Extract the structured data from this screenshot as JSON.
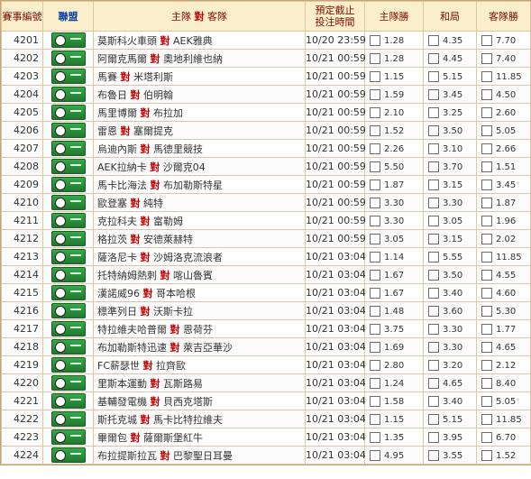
{
  "header": {
    "match_no": "賽事編號",
    "league": "聯盟",
    "home": "主隊",
    "vs": "對",
    "away": "客隊",
    "deadline_line1": "預定截止",
    "deadline_line2": "投注時間",
    "home_win": "主隊勝",
    "draw": "和局",
    "away_win": "客隊勝"
  },
  "vs": "對",
  "rows": [
    {
      "id": "4201",
      "home": "莫斯科火車頭",
      "away": "AEK雅典",
      "time": "10/20 23:59",
      "hw": "1.28",
      "dr": "4.35",
      "aw": "7.70"
    },
    {
      "id": "4202",
      "home": "阿爾克馬爾",
      "away": "奧地利維也納",
      "time": "10/21 00:59",
      "hw": "1.28",
      "dr": "4.45",
      "aw": "7.40"
    },
    {
      "id": "4203",
      "home": "馬賽",
      "away": "米塔利斯",
      "time": "10/21 00:59",
      "hw": "1.15",
      "dr": "5.15",
      "aw": "11.85"
    },
    {
      "id": "4204",
      "home": "布魯日",
      "away": "伯明翰",
      "time": "10/21 00:59",
      "hw": "1.59",
      "dr": "3.45",
      "aw": "4.50"
    },
    {
      "id": "4205",
      "home": "馬里博爾",
      "away": "布拉加",
      "time": "10/21 00:59",
      "hw": "2.10",
      "dr": "3.25",
      "aw": "2.60"
    },
    {
      "id": "4206",
      "home": "雷恩",
      "away": "塞爾提克",
      "time": "10/21 00:59",
      "hw": "1.52",
      "dr": "3.50",
      "aw": "5.05"
    },
    {
      "id": "4207",
      "home": "烏迪內斯",
      "away": "馬德里競技",
      "time": "10/21 00:59",
      "hw": "2.26",
      "dr": "3.10",
      "aw": "2.66"
    },
    {
      "id": "4208",
      "home": "AEK拉納卡",
      "away": "沙爾克04",
      "time": "10/21 00:59",
      "hw": "5.50",
      "dr": "3.70",
      "aw": "1.51"
    },
    {
      "id": "4209",
      "home": "馬卡比海法",
      "away": "布加勒斯特星",
      "time": "10/21 00:59",
      "hw": "1.87",
      "dr": "3.15",
      "aw": "3.45"
    },
    {
      "id": "4210",
      "home": "歐登塞",
      "away": "純特",
      "time": "10/21 00:59",
      "hw": "3.30",
      "dr": "3.30",
      "aw": "1.87"
    },
    {
      "id": "4211",
      "home": "克拉科夫",
      "away": "富勒姆",
      "time": "10/21 00:59",
      "hw": "3.30",
      "dr": "3.05",
      "aw": "1.96"
    },
    {
      "id": "4212",
      "home": "格拉茨",
      "away": "安德萊赫特",
      "time": "10/21 00:59",
      "hw": "3.05",
      "dr": "3.15",
      "aw": "2.02"
    },
    {
      "id": "4213",
      "home": "薩洛尼卡",
      "away": "沙姆洛克流浪者",
      "time": "10/21 03:04",
      "hw": "1.14",
      "dr": "5.55",
      "aw": "11.85"
    },
    {
      "id": "4214",
      "home": "托特納姆熱刺",
      "away": "喀山魯賓",
      "time": "10/21 03:04",
      "hw": "1.67",
      "dr": "3.50",
      "aw": "4.55"
    },
    {
      "id": "4215",
      "home": "漢諾威96",
      "away": "哥本哈根",
      "time": "10/21 03:04",
      "hw": "1.67",
      "dr": "3.40",
      "aw": "4.60"
    },
    {
      "id": "4216",
      "home": "標準列日",
      "away": "沃斯卡拉",
      "time": "10/21 03:04",
      "hw": "1.48",
      "dr": "3.60",
      "aw": "5.30"
    },
    {
      "id": "4217",
      "home": "特拉維夫哈普爾",
      "away": "恩荷芬",
      "time": "10/21 03:04",
      "hw": "3.75",
      "dr": "3.30",
      "aw": "1.77"
    },
    {
      "id": "4218",
      "home": "布加勒斯特迅速",
      "away": "萊吉亞華沙",
      "time": "10/21 03:04",
      "hw": "1.69",
      "dr": "3.30",
      "aw": "4.65"
    },
    {
      "id": "4219",
      "home": "FC薪瑟世",
      "away": "拉齊歐",
      "time": "10/21 03:04",
      "hw": "2.80",
      "dr": "3.20",
      "aw": "2.12"
    },
    {
      "id": "4220",
      "home": "里斯本運動",
      "away": "瓦斯路易",
      "time": "10/21 03:04",
      "hw": "1.24",
      "dr": "4.65",
      "aw": "8.40"
    },
    {
      "id": "4221",
      "home": "基輔發電機",
      "away": "貝西克塔斯",
      "time": "10/21 03:04",
      "hw": "1.58",
      "dr": "3.40",
      "aw": "5.05"
    },
    {
      "id": "4222",
      "home": "斯托克城",
      "away": "馬卡比特拉維夫",
      "time": "10/21 03:04",
      "hw": "1.15",
      "dr": "5.15",
      "aw": "11.85"
    },
    {
      "id": "4223",
      "home": "畢爾包",
      "away": "薩爾斯堡紅牛",
      "time": "10/21 03:04",
      "hw": "1.35",
      "dr": "3.95",
      "aw": "6.70"
    },
    {
      "id": "4224",
      "home": "布拉提斯拉瓦",
      "away": "巴黎聖日耳曼",
      "time": "10/21 03:04",
      "hw": "4.95",
      "dr": "3.55",
      "aw": "1.52"
    }
  ]
}
